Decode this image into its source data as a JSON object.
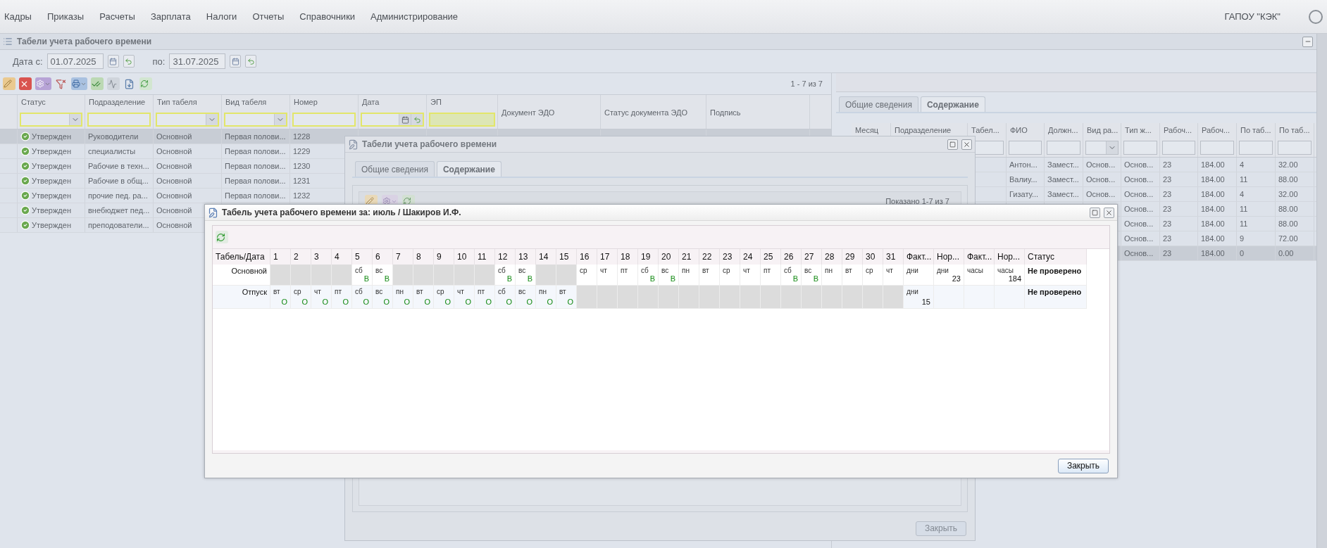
{
  "menu": {
    "items": [
      "Кадры",
      "Приказы",
      "Расчеты",
      "Зарплата",
      "Налоги",
      "Отчеты",
      "Справочники",
      "Администрирование"
    ],
    "organization": "ГАПОУ \"КЭК\""
  },
  "sheets_panel": {
    "title": "Табели учета рабочего времени",
    "date_from_label": "Дата с:",
    "date_from": "01.07.2025",
    "date_to_label": "по:",
    "date_to": "31.07.2025",
    "pager": "1 - 7 из 7",
    "columns": [
      {
        "label": "Статус",
        "kind": "combo"
      },
      {
        "label": "Подразделение",
        "kind": "text"
      },
      {
        "label": "Тип табеля",
        "kind": "combo"
      },
      {
        "label": "Вид табеля",
        "kind": "combo"
      },
      {
        "label": "Номер",
        "kind": "text"
      },
      {
        "label": "Дата",
        "kind": "date"
      },
      {
        "label": "ЭП",
        "kind": "flag"
      },
      {
        "label": "Документ ЭДО",
        "kind": "plain"
      },
      {
        "label": "Статус документа ЭДО",
        "kind": "plain"
      },
      {
        "label": "Подпись",
        "kind": "plain"
      }
    ],
    "rows": [
      {
        "selected": true,
        "cells": [
          "Утвержден",
          "Руководители",
          "Основной",
          "Первая полови...",
          "1228"
        ]
      },
      {
        "selected": false,
        "cells": [
          "Утвержден",
          "специалисты",
          "Основной",
          "Первая полови...",
          "1229"
        ]
      },
      {
        "selected": false,
        "cells": [
          "Утвержден",
          "Рабочие в техн...",
          "Основной",
          "Первая полови...",
          "1230"
        ]
      },
      {
        "selected": false,
        "cells": [
          "Утвержден",
          "Рабочие в общ...",
          "Основной",
          "Первая полови...",
          "1231"
        ]
      },
      {
        "selected": false,
        "cells": [
          "Утвержден",
          "прочие пед. ра...",
          "Основной",
          "Первая полови...",
          "1232"
        ]
      },
      {
        "selected": false,
        "cells": [
          "Утвержден",
          "внебюджет пед...",
          "Основной"
        ]
      },
      {
        "selected": false,
        "cells": [
          "Утвержден",
          "преподователи...",
          "Основной"
        ]
      }
    ]
  },
  "content_panel": {
    "tabs": [
      {
        "label": "Общие сведения",
        "selected": false
      },
      {
        "label": "Содержание",
        "selected": true
      }
    ],
    "columns": [
      {
        "label": "Месяц",
        "kind": "text"
      },
      {
        "label": "Подразделение",
        "kind": "text"
      },
      {
        "label": "Табел...",
        "kind": "text"
      },
      {
        "label": "ФИО",
        "kind": "text"
      },
      {
        "label": "Должн...",
        "kind": "text"
      },
      {
        "label": "Вид ра...",
        "kind": "combo"
      },
      {
        "label": "Тип ж...",
        "kind": "text"
      },
      {
        "label": "Рабоч...",
        "kind": "text"
      },
      {
        "label": "Рабоч...",
        "kind": "text"
      },
      {
        "label": "По таб...",
        "kind": "text"
      },
      {
        "label": "По таб...",
        "kind": "text"
      }
    ],
    "rows": [
      {
        "selected": false,
        "cells": [
          "Антон...",
          "Замест...",
          "Основ...",
          "Основ...",
          "23",
          "184.00",
          "4",
          "32.00"
        ]
      },
      {
        "selected": false,
        "cells": [
          "Валиу...",
          "Замест...",
          "Основ...",
          "Основ...",
          "23",
          "184.00",
          "11",
          "88.00"
        ]
      },
      {
        "selected": false,
        "cells": [
          "Гизату...",
          "Замест...",
          "Основ...",
          "Основ...",
          "23",
          "184.00",
          "4",
          "32.00"
        ]
      },
      {
        "selected": false,
        "cells": [
          "Основ...",
          "23",
          "184.00",
          "11",
          "88.00"
        ]
      },
      {
        "selected": false,
        "cells": [
          "Основ...",
          "23",
          "184.00",
          "11",
          "88.00"
        ]
      },
      {
        "selected": false,
        "cells": [
          "Основ...",
          "23",
          "184.00",
          "9",
          "72.00"
        ]
      },
      {
        "selected": true,
        "cells": [
          "Основ...",
          "23",
          "184.00",
          "0",
          "0.00"
        ]
      }
    ]
  },
  "sheet_window": {
    "title": "Табели учета рабочего времени",
    "tabs": [
      {
        "label": "Общие сведения",
        "selected": false
      },
      {
        "label": "Содержание",
        "selected": true
      }
    ],
    "pager": "Показано 1-7 из 7",
    "close": "Закрыть"
  },
  "timesheet_dialog": {
    "title": "Табель учета рабочего времени за: июль / Шакиров И.Ф.",
    "columns": [
      "Табель/Дата",
      "1",
      "2",
      "3",
      "4",
      "5",
      "6",
      "7",
      "8",
      "9",
      "10",
      "11",
      "12",
      "13",
      "14",
      "15",
      "16",
      "17",
      "18",
      "19",
      "20",
      "21",
      "22",
      "23",
      "24",
      "25",
      "26",
      "27",
      "28",
      "29",
      "30",
      "31",
      "Факт...",
      "Нор...",
      "Факт...",
      "Нор...",
      "Статус"
    ],
    "rows": [
      {
        "label": "Основной",
        "days": [
          {
            "kind": "blank"
          },
          {
            "kind": "blank"
          },
          {
            "kind": "blank"
          },
          {
            "kind": "blank"
          },
          {
            "kind": "day",
            "weekday": "сб",
            "code": "В"
          },
          {
            "kind": "day",
            "weekday": "вс",
            "code": "В"
          },
          {
            "kind": "blank"
          },
          {
            "kind": "blank"
          },
          {
            "kind": "blank"
          },
          {
            "kind": "blank"
          },
          {
            "kind": "blank"
          },
          {
            "kind": "day",
            "weekday": "сб",
            "code": "В"
          },
          {
            "kind": "day",
            "weekday": "вс",
            "code": "В"
          },
          {
            "kind": "blank"
          },
          {
            "kind": "blank"
          },
          {
            "kind": "day",
            "weekday": "ср"
          },
          {
            "kind": "day",
            "weekday": "чт"
          },
          {
            "kind": "day",
            "weekday": "пт"
          },
          {
            "kind": "day",
            "weekday": "сб",
            "code": "В"
          },
          {
            "kind": "day",
            "weekday": "вс",
            "code": "В"
          },
          {
            "kind": "day",
            "weekday": "пн"
          },
          {
            "kind": "day",
            "weekday": "вт"
          },
          {
            "kind": "day",
            "weekday": "ср"
          },
          {
            "kind": "day",
            "weekday": "чт"
          },
          {
            "kind": "day",
            "weekday": "пт"
          },
          {
            "kind": "day",
            "weekday": "сб",
            "code": "В"
          },
          {
            "kind": "day",
            "weekday": "вс",
            "code": "В"
          },
          {
            "kind": "day",
            "weekday": "пн"
          },
          {
            "kind": "day",
            "weekday": "вт"
          },
          {
            "kind": "day",
            "weekday": "ср"
          },
          {
            "kind": "day",
            "weekday": "чт"
          }
        ],
        "totals": [
          {
            "unit": "дни"
          },
          {
            "unit": "дни",
            "value": "23"
          },
          {
            "unit": "часы"
          },
          {
            "unit": "часы",
            "value": "184"
          }
        ],
        "status": "Не проверено"
      },
      {
        "label": "Отпуск",
        "days": [
          {
            "kind": "day",
            "weekday": "вт",
            "code": "О"
          },
          {
            "kind": "day",
            "weekday": "ср",
            "code": "О"
          },
          {
            "kind": "day",
            "weekday": "чт",
            "code": "О"
          },
          {
            "kind": "day",
            "weekday": "пт",
            "code": "О"
          },
          {
            "kind": "day",
            "weekday": "сб",
            "code": "О"
          },
          {
            "kind": "day",
            "weekday": "вс",
            "code": "О"
          },
          {
            "kind": "day",
            "weekday": "пн",
            "code": "О"
          },
          {
            "kind": "day",
            "weekday": "вт",
            "code": "О"
          },
          {
            "kind": "day",
            "weekday": "ср",
            "code": "О"
          },
          {
            "kind": "day",
            "weekday": "чт",
            "code": "О"
          },
          {
            "kind": "day",
            "weekday": "пт",
            "code": "О"
          },
          {
            "kind": "day",
            "weekday": "сб",
            "code": "О"
          },
          {
            "kind": "day",
            "weekday": "вс",
            "code": "О"
          },
          {
            "kind": "day",
            "weekday": "пн",
            "code": "О"
          },
          {
            "kind": "day",
            "weekday": "вт",
            "code": "О"
          },
          {
            "kind": "blank"
          },
          {
            "kind": "blank"
          },
          {
            "kind": "blank"
          },
          {
            "kind": "blank"
          },
          {
            "kind": "blank"
          },
          {
            "kind": "blank"
          },
          {
            "kind": "blank"
          },
          {
            "kind": "blank"
          },
          {
            "kind": "blank"
          },
          {
            "kind": "blank"
          },
          {
            "kind": "blank"
          },
          {
            "kind": "blank"
          },
          {
            "kind": "blank"
          },
          {
            "kind": "blank"
          },
          {
            "kind": "blank"
          },
          {
            "kind": "blank"
          }
        ],
        "totals": [
          {
            "unit": "дни",
            "value": "15"
          }
        ],
        "status": "Не проверено"
      }
    ],
    "close": "Закрыть"
  }
}
